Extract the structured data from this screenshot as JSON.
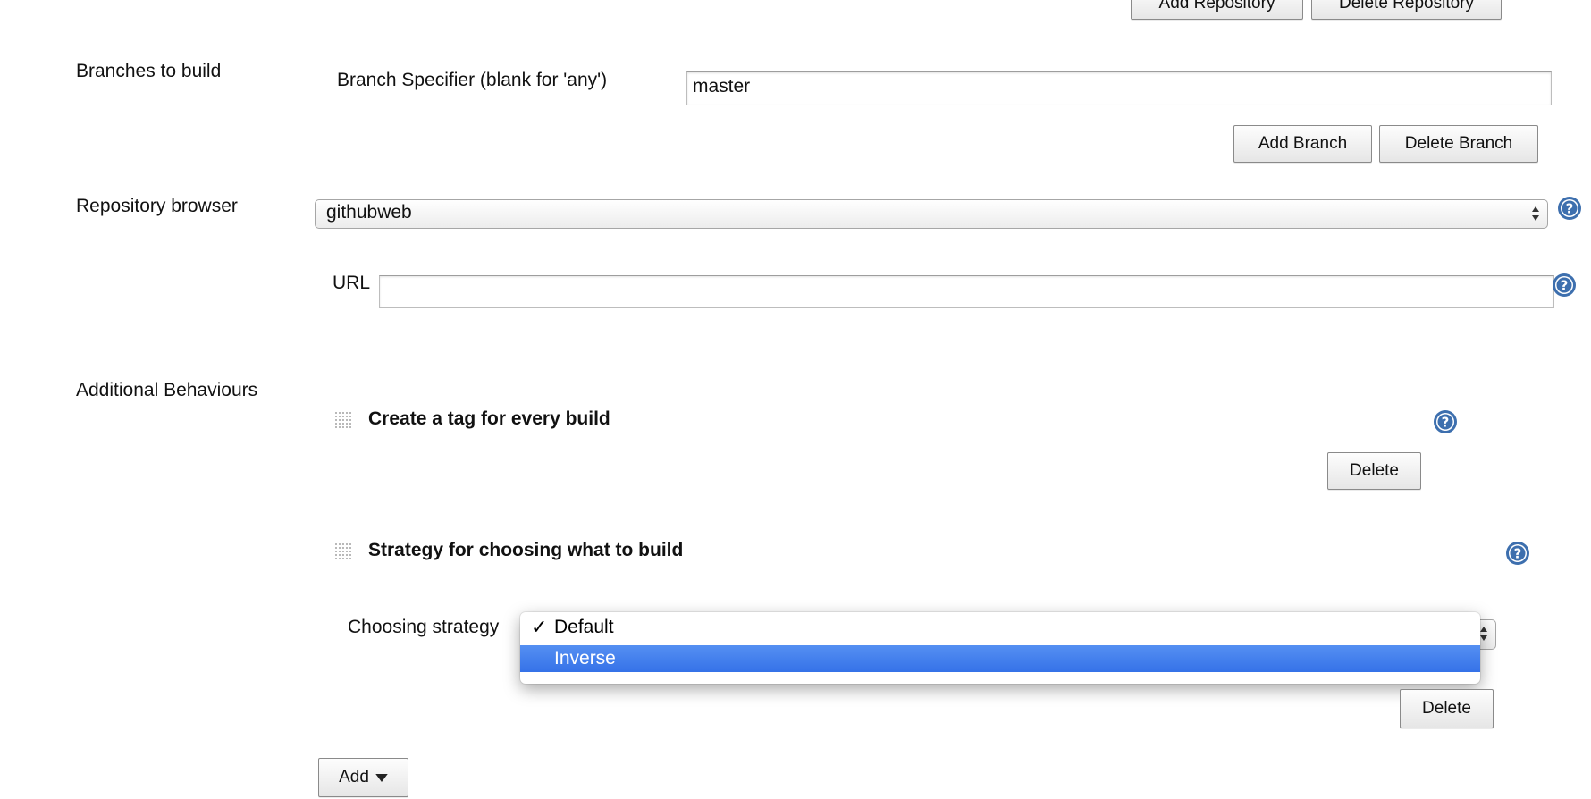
{
  "repositories": {
    "add_label": "Add Repository",
    "delete_label": "Delete Repository"
  },
  "branches": {
    "section_label": "Branches to build",
    "specifier_label": "Branch Specifier (blank for 'any')",
    "specifier_value": "master",
    "add_label": "Add Branch",
    "delete_label": "Delete Branch"
  },
  "repo_browser": {
    "section_label": "Repository browser",
    "selected": "githubweb",
    "url_label": "URL",
    "url_value": ""
  },
  "behaviours": {
    "section_label": "Additional Behaviours",
    "tag": {
      "title": "Create a tag for every build",
      "delete_label": "Delete"
    },
    "strategy": {
      "title": "Strategy for choosing what to build",
      "choosing_label": "Choosing strategy",
      "options": [
        "Default",
        "Inverse"
      ],
      "checked_option": "Default",
      "highlighted_option": "Inverse",
      "delete_label": "Delete"
    },
    "add_label": "Add"
  },
  "icons": {
    "help": "help-icon",
    "grip": "drag-handle-icon",
    "updown": "updown-arrows-icon",
    "dropdown": "caret-down-icon",
    "check": "checkmark-icon"
  },
  "colors": {
    "help_blue": "#3d6fae",
    "selection_blue": "#3f7ae9"
  }
}
